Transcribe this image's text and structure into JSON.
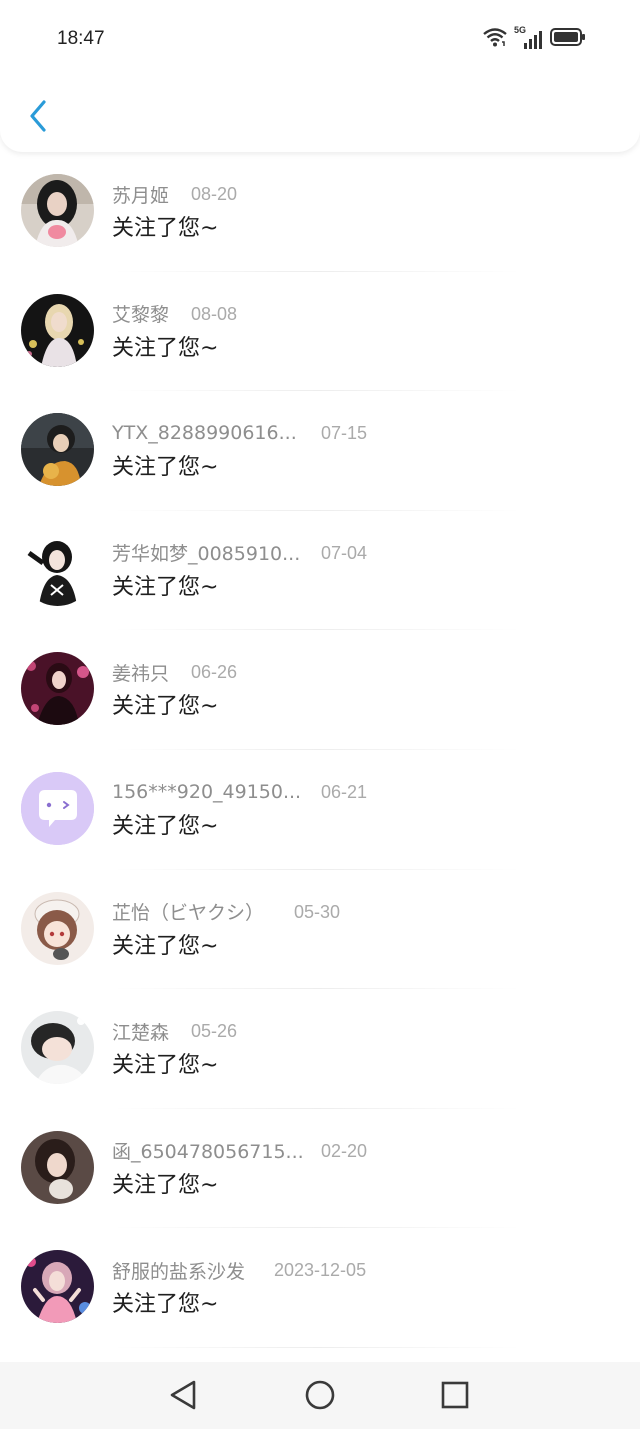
{
  "status_bar": {
    "time": "18:47",
    "network_label": "5G"
  },
  "header": {
    "back_icon": "chevron-left-icon",
    "accent_color": "#2a9bd8"
  },
  "notifications": [
    {
      "name": "苏月姬",
      "date": "08-20",
      "message": "关注了您~"
    },
    {
      "name": "艾黎黎",
      "date": "08-08",
      "message": "关注了您~"
    },
    {
      "name": "YTX_8288990616...",
      "date": "07-15",
      "message": "关注了您~"
    },
    {
      "name": "芳华如梦_0085910...",
      "date": "07-04",
      "message": "关注了您~"
    },
    {
      "name": "姜祎只",
      "date": "06-26",
      "message": "关注了您~"
    },
    {
      "name": "156***920_49150...",
      "date": "06-21",
      "message": "关注了您~"
    },
    {
      "name": "芷怡（ビヤクシ）",
      "date": "05-30",
      "message": "关注了您~"
    },
    {
      "name": "江楚森",
      "date": "05-26",
      "message": "关注了您~"
    },
    {
      "name": "函_650478056715...",
      "date": "02-20",
      "message": "关注了您~"
    },
    {
      "name": "舒服的盐系沙发",
      "date": "2023-12-05",
      "message": "关注了您~"
    }
  ],
  "nav_bar": {
    "back_icon": "triangle-back-icon",
    "home_icon": "circle-home-icon",
    "recents_icon": "square-recents-icon"
  }
}
